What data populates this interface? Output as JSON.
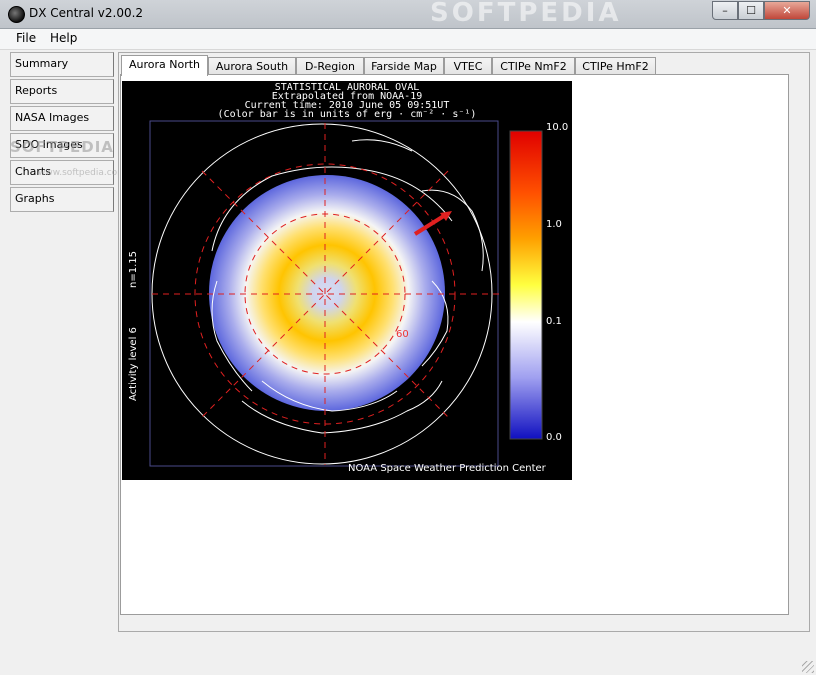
{
  "window": {
    "title": "DX Central  v2.00.2",
    "watermark": "SOFTPEDIA",
    "controls": {
      "minimize": "–",
      "maximize": "☐",
      "close": "✕"
    }
  },
  "menu": {
    "file": "File",
    "help": "Help"
  },
  "nav": {
    "items": [
      {
        "label": "Summary"
      },
      {
        "label": "Reports"
      },
      {
        "label": "NASA Images"
      },
      {
        "label": "SDO Images"
      },
      {
        "label": "Charts"
      },
      {
        "label": "Graphs"
      }
    ],
    "watermark": "SOFTPEDIA",
    "watermark_url": "www.softpedia.com"
  },
  "tabs": [
    {
      "label": "Aurora North",
      "active": true
    },
    {
      "label": "Aurora South"
    },
    {
      "label": "D-Region"
    },
    {
      "label": "Farside Map"
    },
    {
      "label": "VTEC"
    },
    {
      "label": "CTIPe NmF2"
    },
    {
      "label": "CTIPe HmF2"
    }
  ],
  "aurora_image": {
    "header": [
      "STATISTICAL AURORAL OVAL",
      "Extrapolated from NOAA-19",
      "Current time: 2010 June 05 09:51UT",
      "(Color bar is in units of erg · cm⁻² · s⁻¹)"
    ],
    "colorbar_ticks": [
      "10.0",
      "1.0",
      "0.1",
      "0.0"
    ],
    "side_label_n": "n=1.15",
    "side_label_activity": "Activity level 6",
    "latitude_label": "60",
    "credit": "NOAA Space Weather Prediction Center"
  }
}
